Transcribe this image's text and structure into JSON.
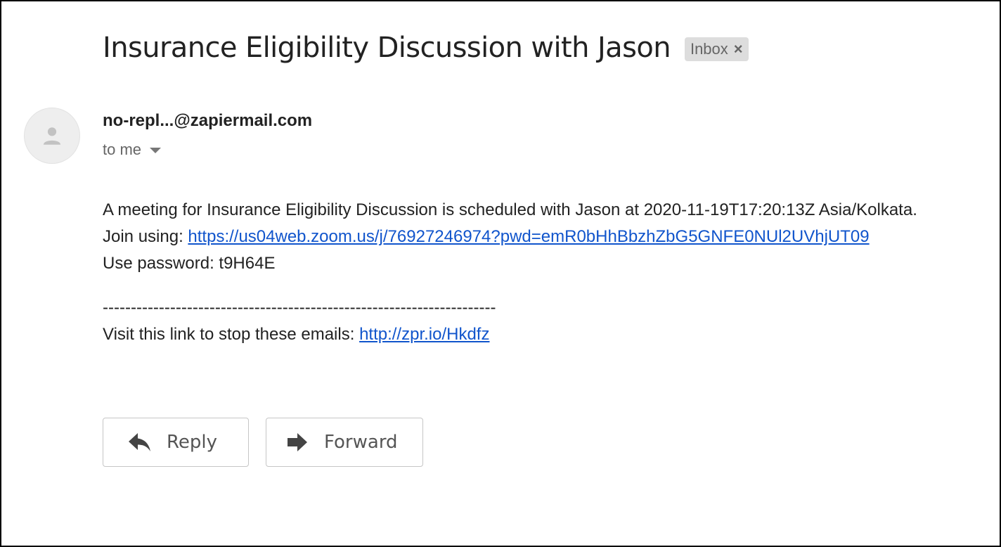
{
  "email": {
    "subject": "Insurance Eligibility Discussion with Jason",
    "label": {
      "text": "Inbox",
      "close": "×"
    },
    "sender": "no-repl...@zapiermail.com",
    "recipient": "to me",
    "body": {
      "line1": "A meeting for Insurance Eligibility Discussion is scheduled with Jason at 2020-11-19T17:20:13Z Asia/Kolkata.",
      "join_prefix": "Join using: ",
      "join_link": "https://us04web.zoom.us/j/76927246974?pwd=emR0bHhBbzhZbG5GNFE0NUl2UVhjUT09",
      "password": "Use password: t9H64E",
      "separator": "----------------------------------------------------------------------",
      "unsubscribe_prefix": "Visit this link to stop these emails: ",
      "unsubscribe_link": "http://zpr.io/Hkdfz"
    }
  },
  "actions": {
    "reply": {
      "label": "Reply",
      "icon": "reply-arrow-icon"
    },
    "forward": {
      "label": "Forward",
      "icon": "forward-arrow-icon"
    }
  },
  "colors": {
    "link": "#1155cc",
    "text": "#222222",
    "muted": "#666666",
    "chip_bg": "#dddddd"
  }
}
